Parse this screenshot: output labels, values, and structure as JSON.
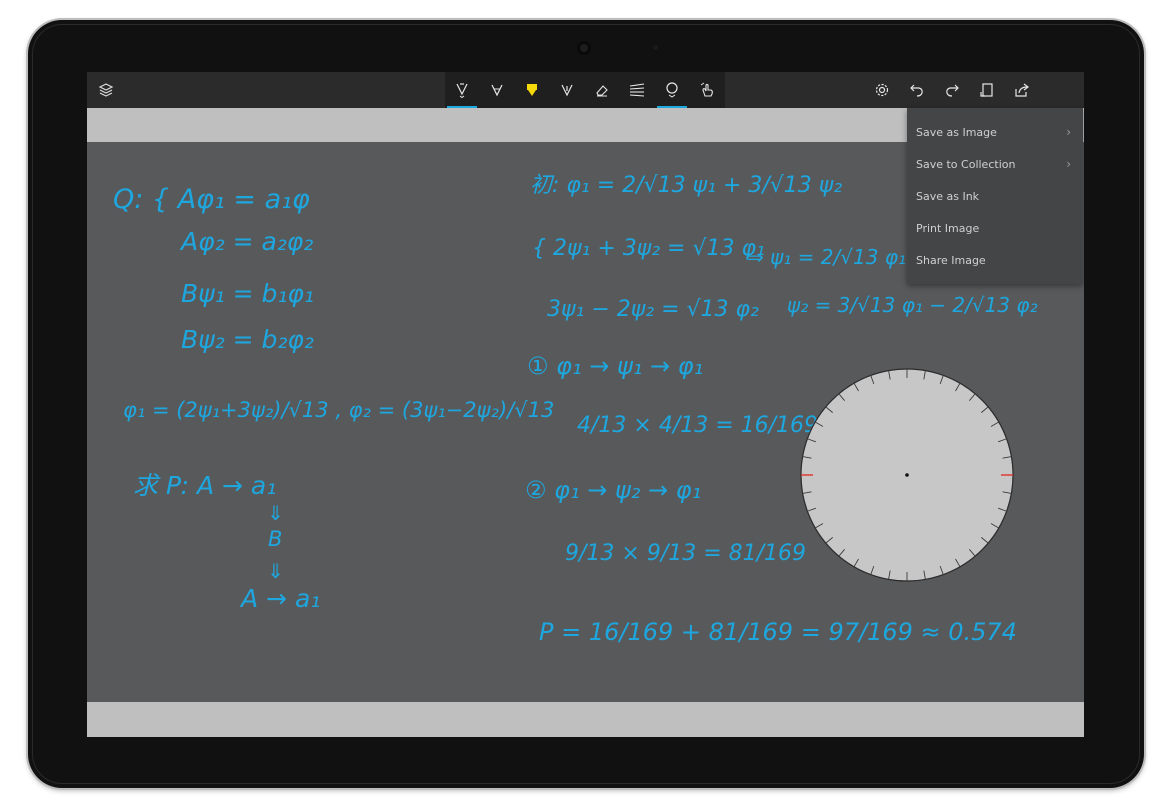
{
  "toolbar": {
    "icons": [
      "layers-icon",
      "ballpoint-pen-icon",
      "pencil-icon",
      "highlighter-icon",
      "calligraphy-pen-icon",
      "eraser-icon",
      "ruler-icon",
      "protractor-icon",
      "touch-writing-icon",
      "settings-icon",
      "undo-icon",
      "redo-icon",
      "full-screen-icon",
      "share-icon"
    ],
    "highlighter_color": "#f5d90a",
    "accent_color": "#1fa9e1"
  },
  "share_menu": {
    "items": [
      {
        "label": "Save as Image",
        "has_submenu": true
      },
      {
        "label": "Save to Collection",
        "has_submenu": true
      },
      {
        "label": "Save as Ink",
        "has_submenu": false
      },
      {
        "label": "Print Image",
        "has_submenu": false
      },
      {
        "label": "Share Image",
        "has_submenu": false
      }
    ]
  },
  "ink": {
    "color": "#1ea7df",
    "left_column": [
      "Q: { Aφ₁ = a₁φ",
      "Aφ₂ = a₂φ₂",
      "Bψ₁ = b₁φ₁",
      "Bψ₂ = b₂φ₂",
      "φ₁ = (2ψ₁+3ψ₂)/√13 , φ₂ = (3ψ₁−2ψ₂)/√13",
      "求 P:  A → a₁",
      "⇓",
      "B",
      "⇓",
      "A → a₁"
    ],
    "right_column": [
      "初: φ₁ = 2/√13 ψ₁ + 3/√13 ψ₂",
      "{ 2ψ₁ + 3ψ₂ = √13 φ₁",
      "3ψ₁ − 2ψ₂ = √13 φ₂",
      "⇒  ψ₁ = 2/√13 φ₁ + 3/√13 φ₂",
      "ψ₂ = 3/√13 φ₁ − 2/√13 φ₂",
      "① φ₁ → ψ₁ → φ₁",
      "4/13 × 4/13 = 16/169",
      "② φ₁ → ψ₂ → φ₁",
      "9/13 × 9/13 = 81/169",
      "P = 16/169 + 81/169 = 97/169 ≈ 0.574"
    ]
  },
  "protractor": {
    "tick_count": 36,
    "marker_color": "#e0302a"
  }
}
